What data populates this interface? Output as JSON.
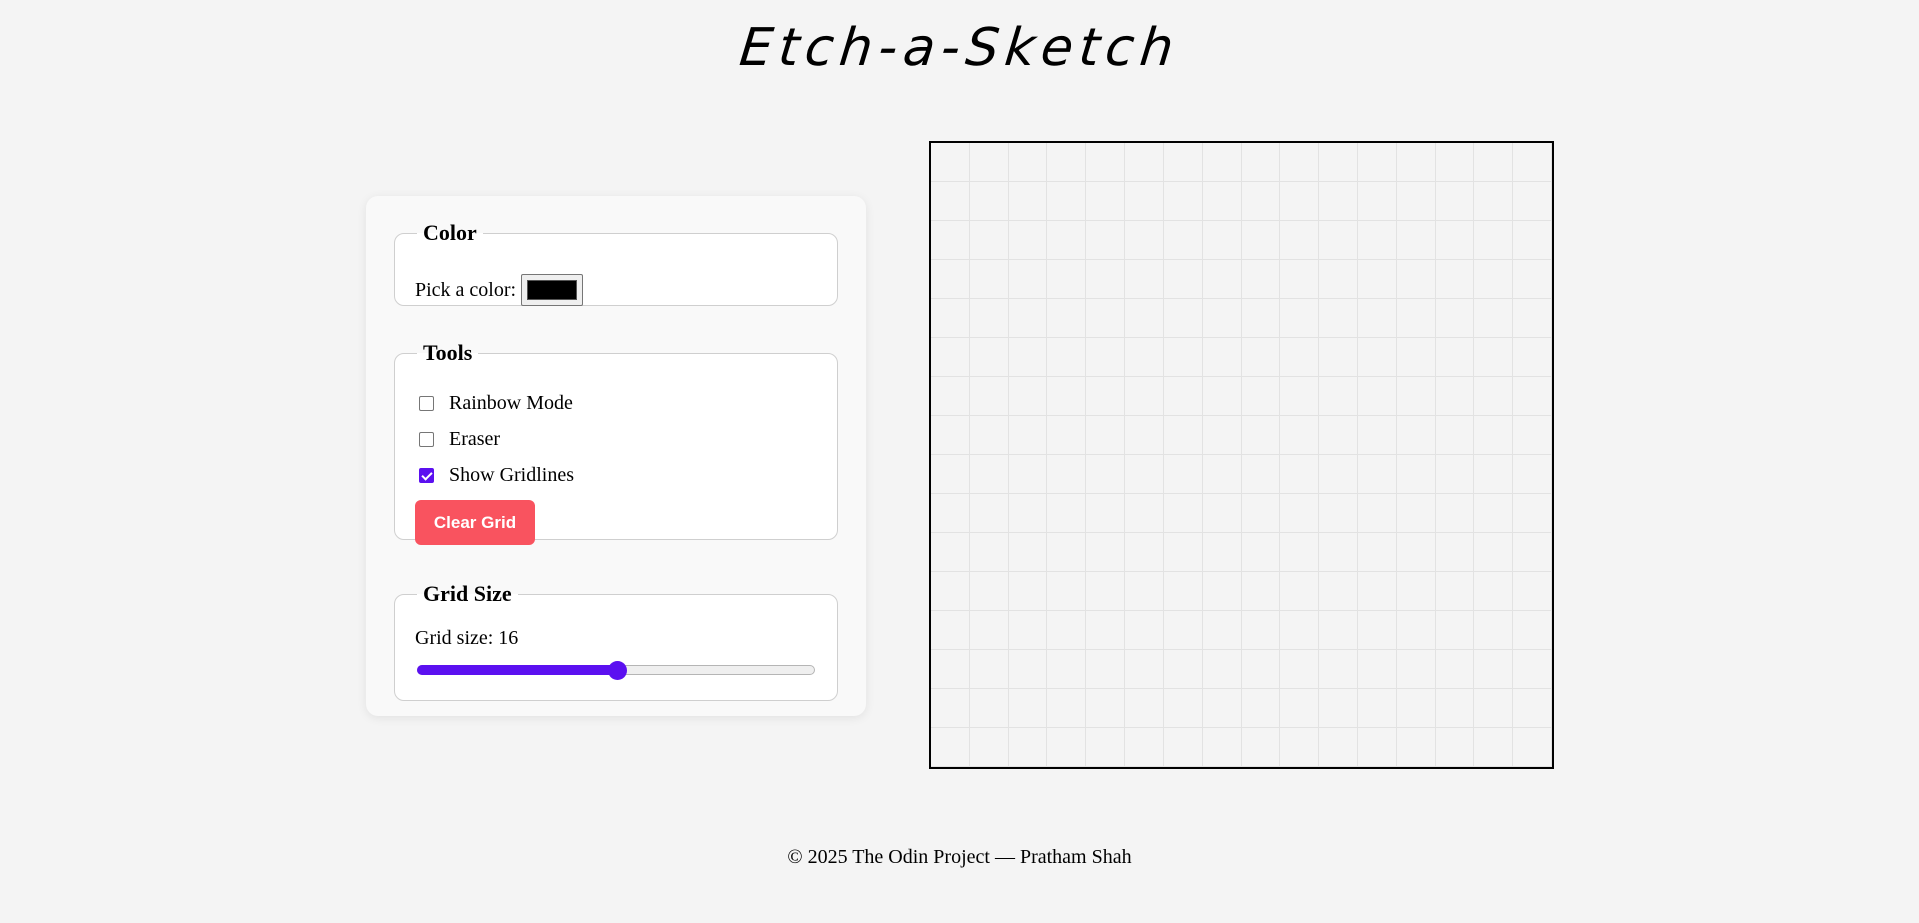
{
  "header": {
    "title": "Etch-a-Sketch"
  },
  "controls": {
    "color": {
      "legend": "Color",
      "label": "Pick a color:",
      "value": "#000000"
    },
    "tools": {
      "legend": "Tools",
      "options": [
        {
          "label": "Rainbow Mode",
          "checked": false
        },
        {
          "label": "Eraser",
          "checked": false
        },
        {
          "label": "Show Gridlines",
          "checked": true
        }
      ],
      "clear_label": "Clear Grid",
      "clear_color": "#f9535f"
    },
    "grid_size": {
      "legend": "Grid Size",
      "label": "Grid size: 16",
      "value": 16,
      "slider_fraction": 0.5
    }
  },
  "grid": {
    "size": 16,
    "gridlines": true
  },
  "colors": {
    "accent": "#5b10f0",
    "background": "#f4f4f4"
  },
  "footer": {
    "text": "© 2025 The Odin Project — Pratham Shah"
  }
}
